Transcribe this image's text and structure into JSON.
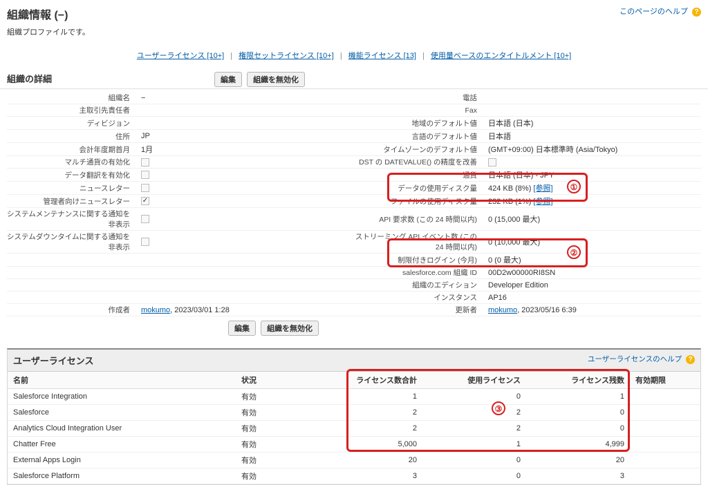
{
  "page": {
    "title": "組織情報 (−)",
    "subtitle": "組織プロファイルです。",
    "help_label": "このページのヘルプ"
  },
  "nav": {
    "user_lic": "ユーザーライセンス [10+]",
    "perm_lic": "権限セットライセンス [10+]",
    "feat_lic": "機能ライセンス [13]",
    "usage_ent": "使用量ベースのエンタイトルメント [10+]"
  },
  "section": {
    "detail_title": "組織の詳細",
    "edit_btn": "編集",
    "deactivate_btn": "組織を無効化"
  },
  "detail_left": {
    "org_name_label": "組織名",
    "org_name_value": "−",
    "primary_contact_label": "主取引先責任者",
    "primary_contact_value": "",
    "division_label": "ディビジョン",
    "division_value": "",
    "address_label": "住所",
    "address_value": "JP",
    "fiscal_year_start_label": "会計年度期首月",
    "fiscal_year_start_value": "1月",
    "multi_currency_label": "マルチ通貨の有効化",
    "data_translation_label": "データ翻訳を有効化",
    "newsletter_label": "ニュースレター",
    "admin_newsletter_label": "管理者向けニュースレター",
    "hide_maint_notice_label": "システムメンテナンスに関する通知を非表示",
    "hide_downtime_notice_label": "システムダウンタイムに関する通知を非表示",
    "created_by_label": "作成者",
    "created_by_user": "mokumo",
    "created_by_date": ", 2023/03/01 1:28"
  },
  "detail_right": {
    "phone_label": "電話",
    "phone_value": "",
    "fax_label": "Fax",
    "fax_value": "",
    "locale_default_label": "地域のデフォルト値",
    "locale_default_value": "日本語 (日本)",
    "lang_default_label": "言語のデフォルト値",
    "lang_default_value": "日本語",
    "tz_default_label": "タイムゾーンのデフォルト値",
    "tz_default_value": "(GMT+09:00) 日本標準時 (Asia/Tokyo)",
    "dst_datevalue_label": "DST の DATEVALUE() の精度を改善",
    "currency_label": "通貨",
    "currency_value": "日本語 (日本) - JPY",
    "data_disk_label": "データの使用ディスク量",
    "data_disk_value": "424 KB (8%) ",
    "data_disk_link": "[参照]",
    "file_disk_label": "ファイルの使用ディスク量",
    "file_disk_value": "232 KB (1%) ",
    "file_disk_link": "[参照]",
    "api_req_label": "API 要求数 (この 24 時間以内)",
    "api_req_value": "0 (15,000 最大)",
    "stream_api_label": "ストリーミング API イベント数 (この 24 時間以内)",
    "stream_api_value": "0 (10,000 最大)",
    "restricted_login_label": "制限付きログイン (今月)",
    "restricted_login_value": "0 (0 最大)",
    "org_id_label": "salesforce.com 組織 ID",
    "org_id_value": "00D2w00000RI8SN",
    "edition_label": "組織のエディション",
    "edition_value": "Developer Edition",
    "instance_label": "インスタンス",
    "instance_value": "AP16",
    "updated_by_label": "更新者",
    "updated_by_user": "mokumo",
    "updated_by_date": ", 2023/05/16 6:39"
  },
  "license_section": {
    "title": "ユーザーライセンス",
    "help": "ユーザーライセンスのヘルプ",
    "col_name": "名前",
    "col_status": "状況",
    "col_total": "ライセンス数合計",
    "col_used": "使用ライセンス",
    "col_remaining": "ライセンス残数",
    "col_expiry": "有効期限"
  },
  "licenses": [
    {
      "name": "Salesforce Integration",
      "status": "有効",
      "total": "1",
      "used": "0",
      "remaining": "1",
      "expiry": ""
    },
    {
      "name": "Salesforce",
      "status": "有効",
      "total": "2",
      "used": "2",
      "remaining": "0",
      "expiry": ""
    },
    {
      "name": "Analytics Cloud Integration User",
      "status": "有効",
      "total": "2",
      "used": "2",
      "remaining": "0",
      "expiry": ""
    },
    {
      "name": "Chatter Free",
      "status": "有効",
      "total": "5,000",
      "used": "1",
      "remaining": "4,999",
      "expiry": ""
    },
    {
      "name": "External Apps Login",
      "status": "有効",
      "total": "20",
      "used": "0",
      "remaining": "20",
      "expiry": ""
    },
    {
      "name": "Salesforce Platform",
      "status": "有効",
      "total": "3",
      "used": "0",
      "remaining": "3",
      "expiry": ""
    }
  ],
  "callouts": {
    "one": "①",
    "two": "②",
    "three": "③"
  }
}
